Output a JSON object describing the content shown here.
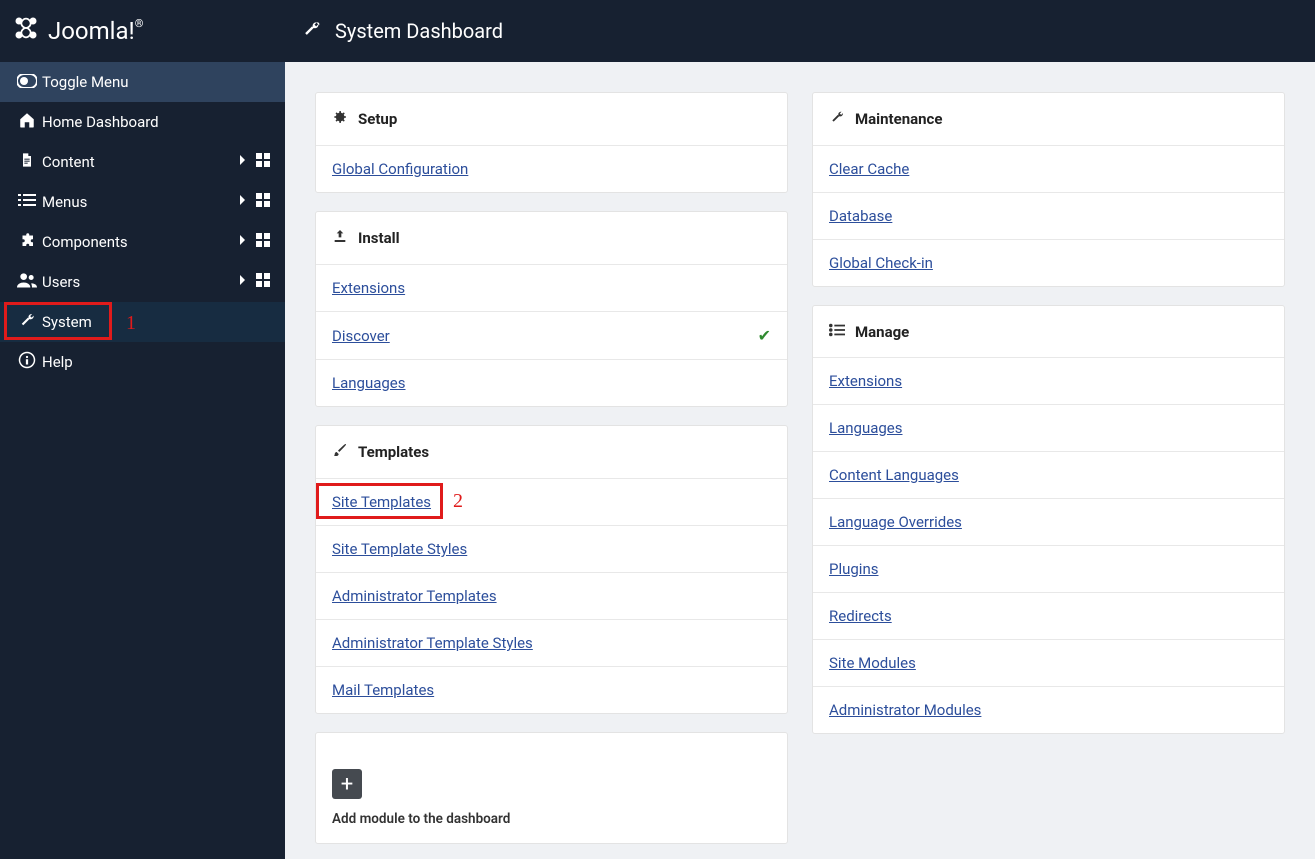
{
  "brand": "Joomla!",
  "page_title": "System Dashboard",
  "sidebar": {
    "toggle": "Toggle Menu",
    "items": [
      {
        "icon": "home",
        "label": "Home Dashboard",
        "chev": false,
        "grid": false
      },
      {
        "icon": "file",
        "label": "Content",
        "chev": true,
        "grid": true
      },
      {
        "icon": "list",
        "label": "Menus",
        "chev": true,
        "grid": true
      },
      {
        "icon": "puzzle",
        "label": "Components",
        "chev": true,
        "grid": true
      },
      {
        "icon": "users",
        "label": "Users",
        "chev": true,
        "grid": true
      },
      {
        "icon": "wrench",
        "label": "System",
        "chev": false,
        "grid": false,
        "active": true
      },
      {
        "icon": "info",
        "label": "Help",
        "chev": false,
        "grid": false
      }
    ]
  },
  "left_cards": [
    {
      "icon": "gear",
      "title": "Setup",
      "links": [
        {
          "label": "Global Configuration"
        }
      ]
    },
    {
      "icon": "upload",
      "title": "Install",
      "links": [
        {
          "label": "Extensions"
        },
        {
          "label": "Discover",
          "check": true
        },
        {
          "label": "Languages"
        }
      ]
    },
    {
      "icon": "brush",
      "title": "Templates",
      "links": [
        {
          "label": "Site Templates"
        },
        {
          "label": "Site Template Styles"
        },
        {
          "label": "Administrator Templates"
        },
        {
          "label": "Administrator Template Styles"
        },
        {
          "label": "Mail Templates"
        }
      ]
    }
  ],
  "right_cards": [
    {
      "icon": "wrench",
      "title": "Maintenance",
      "links": [
        {
          "label": "Clear Cache"
        },
        {
          "label": "Database"
        },
        {
          "label": "Global Check-in"
        }
      ]
    },
    {
      "icon": "listul",
      "title": "Manage",
      "links": [
        {
          "label": "Extensions"
        },
        {
          "label": "Languages"
        },
        {
          "label": "Content Languages"
        },
        {
          "label": "Language Overrides"
        },
        {
          "label": "Plugins"
        },
        {
          "label": "Redirects"
        },
        {
          "label": "Site Modules"
        },
        {
          "label": "Administrator Modules"
        }
      ]
    }
  ],
  "add_module": "Add module to the dashboard",
  "annotations": {
    "one": "1",
    "two": "2"
  }
}
